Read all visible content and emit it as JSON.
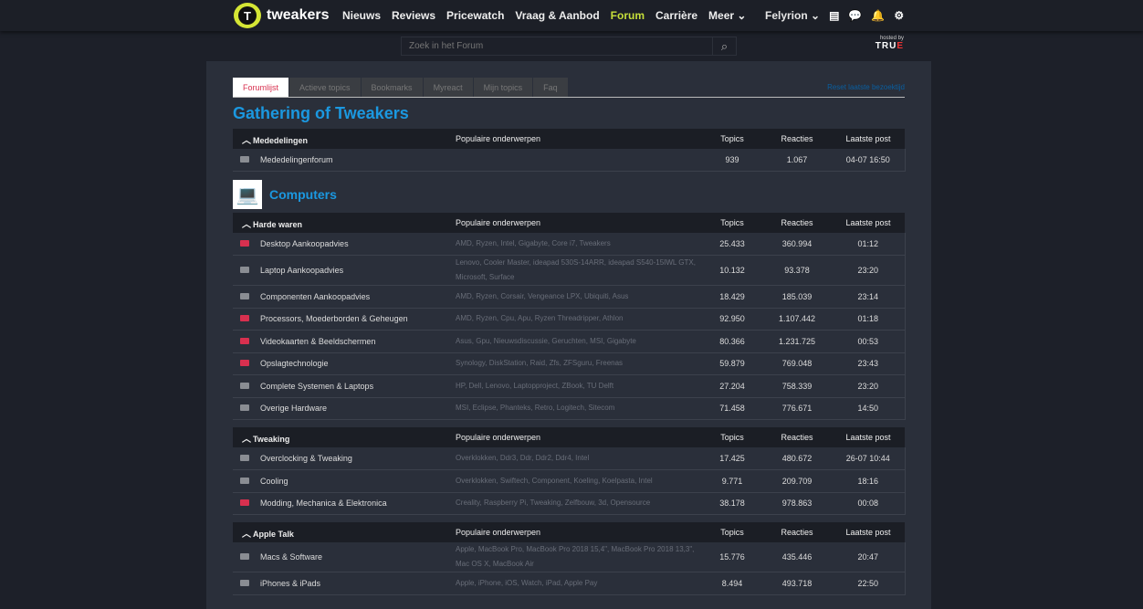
{
  "header": {
    "logo_text": "tweakers",
    "nav": [
      "Nieuws",
      "Reviews",
      "Pricewatch",
      "Vraag & Aanbod",
      "Forum",
      "Carrière",
      "Meer ⌄"
    ],
    "active": "Forum",
    "user": "Felyrion ⌄"
  },
  "search": {
    "placeholder": "Zoek in het Forum",
    "hosted_by": "hosted by",
    "host": "TRU",
    "host_accent": "E"
  },
  "tabs": [
    "Forumlijst",
    "Actieve topics",
    "Bookmarks",
    "Myreact",
    "Mijn topics",
    "Faq"
  ],
  "reset_link": "Reset laatste bezoektijd",
  "page_title": "Gathering of Tweakers",
  "col": {
    "pop": "Populaire onderwerpen",
    "topics": "Topics",
    "reacties": "Reacties",
    "laatste": "Laatste post"
  },
  "groups": [
    {
      "category": null,
      "name": "Mededelingen",
      "show_pop": false,
      "rows": [
        {
          "name": "Mededelingenforum",
          "pop": "",
          "topics": "939",
          "reacties": "1.067",
          "last": "04-07 16:50",
          "red": false
        }
      ]
    },
    {
      "category": "Computers",
      "name": "Harde waren",
      "show_pop": true,
      "rows": [
        {
          "name": "Desktop Aankoopadvies",
          "pop": "AMD, Ryzen, Intel, Gigabyte, Core i7, Tweakers",
          "topics": "25.433",
          "reacties": "360.994",
          "last": "01:12",
          "red": true
        },
        {
          "name": "Laptop Aankoopadvies",
          "pop": "Lenovo, Cooler Master, ideapad 530S-14ARR, ideapad S540-15IWL GTX, Microsoft, Surface",
          "topics": "10.132",
          "reacties": "93.378",
          "last": "23:20",
          "red": false
        },
        {
          "name": "Componenten Aankoopadvies",
          "pop": "AMD, Ryzen, Corsair, Vengeance LPX, Ubiquiti, Asus",
          "topics": "18.429",
          "reacties": "185.039",
          "last": "23:14",
          "red": false
        },
        {
          "name": "Processors, Moederborden & Geheugen",
          "pop": "AMD, Ryzen, Cpu, Apu, Ryzen Threadripper, Athlon",
          "topics": "92.950",
          "reacties": "1.107.442",
          "last": "01:18",
          "red": true
        },
        {
          "name": "Videokaarten & Beeldschermen",
          "pop": "Asus, Gpu, Nieuwsdiscussie, Geruchten, MSI, Gigabyte",
          "topics": "80.366",
          "reacties": "1.231.725",
          "last": "00:53",
          "red": true
        },
        {
          "name": "Opslagtechnologie",
          "pop": "Synology, DiskStation, Raid, Zfs, ZFSguru, Freenas",
          "topics": "59.879",
          "reacties": "769.048",
          "last": "23:43",
          "red": true
        },
        {
          "name": "Complete Systemen & Laptops",
          "pop": "HP, Dell, Lenovo, Laptopproject, ZBook, TU Delft",
          "topics": "27.204",
          "reacties": "758.339",
          "last": "23:20",
          "red": false
        },
        {
          "name": "Overige Hardware",
          "pop": "MSI, Eclipse, Phanteks, Retro, Logitech, Sitecom",
          "topics": "71.458",
          "reacties": "776.671",
          "last": "14:50",
          "red": false
        }
      ]
    },
    {
      "category": null,
      "name": "Tweaking",
      "show_pop": true,
      "rows": [
        {
          "name": "Overclocking & Tweaking",
          "pop": "Overklokken, Ddr3, Ddr, Ddr2, Ddr4, Intel",
          "topics": "17.425",
          "reacties": "480.672",
          "last": "26-07 10:44",
          "red": false
        },
        {
          "name": "Cooling",
          "pop": "Overklokken, Swiftech, Component, Koeling, Koelpasta, Intel",
          "topics": "9.771",
          "reacties": "209.709",
          "last": "18:16",
          "red": false
        },
        {
          "name": "Modding, Mechanica & Elektronica",
          "pop": "Creality, Raspberry Pi, Tweaking, Zelfbouw, 3d, Opensource",
          "topics": "38.178",
          "reacties": "978.863",
          "last": "00:08",
          "red": true
        }
      ]
    },
    {
      "category": null,
      "name": "Apple Talk",
      "show_pop": true,
      "rows": [
        {
          "name": "Macs & Software",
          "pop": "Apple, MacBook Pro, MacBook Pro 2018 15,4\", MacBook Pro 2018 13,3\", Mac OS X, MacBook Air",
          "topics": "15.776",
          "reacties": "435.446",
          "last": "20:47",
          "red": false
        },
        {
          "name": "iPhones & iPads",
          "pop": "Apple, iPhone, iOS, Watch, iPad, Apple Pay",
          "topics": "8.494",
          "reacties": "493.718",
          "last": "22:50",
          "red": false
        }
      ]
    }
  ]
}
